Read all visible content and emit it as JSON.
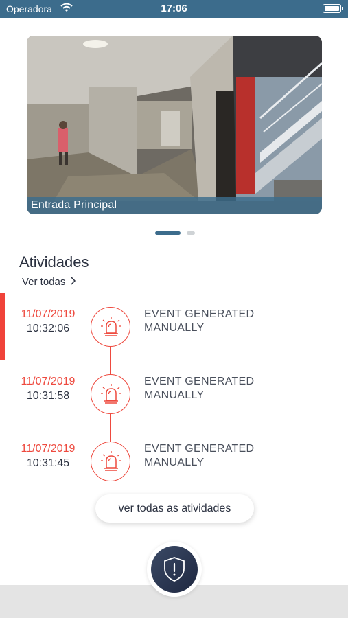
{
  "status_bar": {
    "carrier": "Operadora",
    "time": "17:06"
  },
  "camera": {
    "name": "Entrada Principal"
  },
  "pager": {
    "pages": 2,
    "active": 1
  },
  "activities": {
    "title": "Atividades",
    "see_all_label": "Ver todas",
    "events": [
      {
        "date": "11/07/2019",
        "time": "10:32:06",
        "desc_line1": "EVENT GENERATED",
        "desc_line2": "MANUALLY",
        "icon": "alarm-siren-icon"
      },
      {
        "date": "11/07/2019",
        "time": "10:31:58",
        "desc_line1": "EVENT GENERATED",
        "desc_line2": "MANUALLY",
        "icon": "alarm-siren-icon"
      },
      {
        "date": "11/07/2019",
        "time": "10:31:45",
        "desc_line1": "EVENT GENERATED",
        "desc_line2": "MANUALLY",
        "icon": "alarm-siren-icon"
      }
    ],
    "view_all_button": "ver todas as atividades"
  },
  "fab": {
    "icon": "shield-alert-icon"
  },
  "colors": {
    "accent": "#3c6c8c",
    "alert": "#ee4a3f",
    "fab": "#26304a"
  }
}
